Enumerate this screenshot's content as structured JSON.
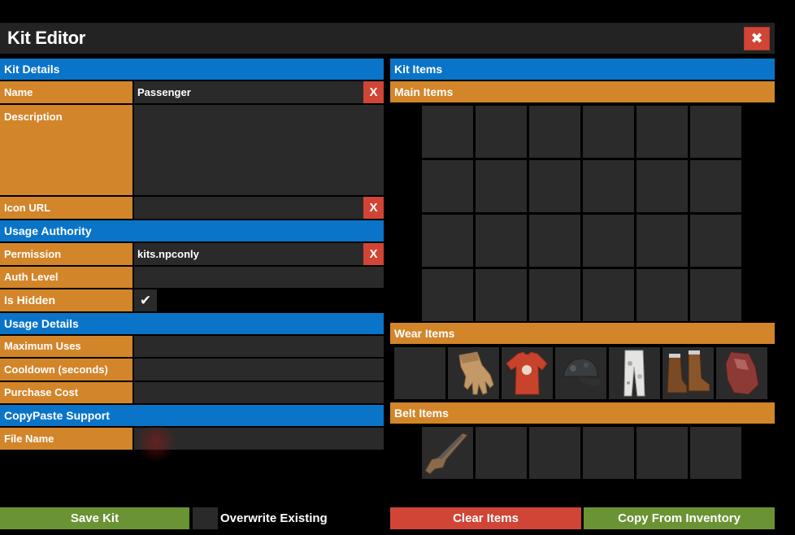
{
  "window": {
    "title": "Kit Editor",
    "close_glyph": "✖"
  },
  "kit_details": {
    "header": "Kit Details",
    "name_label": "Name",
    "name_value": "Passenger",
    "description_label": "Description",
    "description_value": "",
    "icon_url_label": "Icon URL",
    "icon_url_value": "",
    "clear_glyph": "X"
  },
  "usage_authority": {
    "header": "Usage Authority",
    "permission_label": "Permission",
    "permission_value": "kits.npconly",
    "auth_level_label": "Auth Level",
    "auth_level_value": "",
    "is_hidden_label": "Is Hidden",
    "is_hidden_check": "✔"
  },
  "usage_details": {
    "header": "Usage Details",
    "max_uses_label": "Maximum Uses",
    "cooldown_label": "Cooldown (seconds)",
    "purchase_cost_label": "Purchase Cost"
  },
  "copypaste": {
    "header": "CopyPaste Support",
    "file_name_label": "File Name",
    "file_name_value": ""
  },
  "kit_items": {
    "header": "Kit Items",
    "main_header": "Main Items",
    "wear_header": "Wear Items",
    "belt_header": "Belt Items",
    "wear_slots": [
      "",
      "burlap-gloves-icon",
      "red-tshirt-icon",
      "camo-cap-icon",
      "snow-camo-pants-icon",
      "leather-boots-icon",
      "burlap-headwrap-icon"
    ],
    "belt_slots": [
      "rifle-icon",
      "",
      "",
      "",
      "",
      ""
    ]
  },
  "footer": {
    "save_label": "Save Kit",
    "overwrite_label": "Overwrite Existing",
    "clear_label": "Clear Items",
    "copy_label": "Copy From Inventory"
  },
  "colors": {
    "blue": "#0a74c9",
    "orange": "#d3852a",
    "red": "#d04535",
    "green": "#6a9333",
    "panel": "#2a2a2a"
  }
}
